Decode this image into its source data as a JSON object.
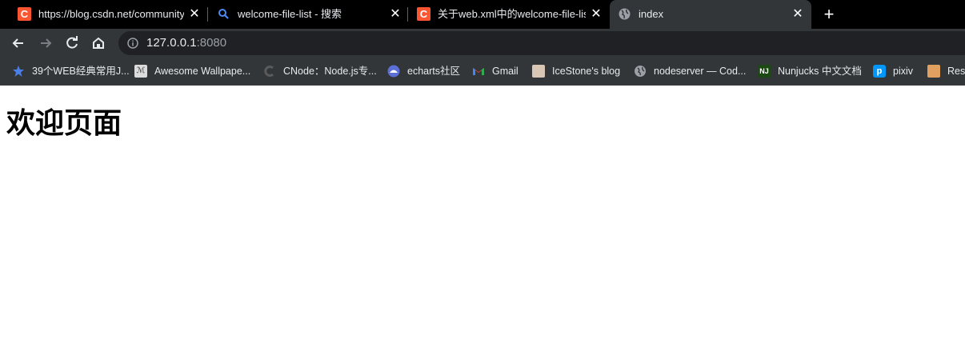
{
  "tabs": [
    {
      "title": "https://blog.csdn.net/community",
      "favicon": "csdn-icon",
      "active": false
    },
    {
      "title": "welcome-file-list - 搜索",
      "favicon": "search-icon",
      "active": false
    },
    {
      "title": "关于web.xml中的welcome-file-list",
      "favicon": "csdn-icon",
      "active": false
    },
    {
      "title": "index",
      "favicon": "globe-icon",
      "active": true
    }
  ],
  "toolbar": {
    "url_host": "127.0.0.1",
    "url_port": ":8080"
  },
  "bookmarks": [
    {
      "label": "39个WEB经典常用J...",
      "icon": "bookmark-star-icon"
    },
    {
      "label": "Awesome Wallpape...",
      "icon": "wallpaper-icon"
    },
    {
      "label": "CNode：Node.js专...",
      "icon": "cnode-icon"
    },
    {
      "label": "echarts社区",
      "icon": "echarts-icon"
    },
    {
      "label": "Gmail",
      "icon": "gmail-icon"
    },
    {
      "label": "IceStone's blog",
      "icon": "avatar-icon"
    },
    {
      "label": "nodeserver — Cod...",
      "icon": "globe-icon"
    },
    {
      "label": "Nunjucks 中文文档",
      "icon": "nunjucks-icon"
    },
    {
      "label": "pixiv",
      "icon": "pixiv-icon"
    },
    {
      "label": "Rese",
      "icon": "avatar-icon"
    }
  ],
  "page": {
    "heading": "欢迎页面"
  },
  "colors": {
    "tabstrip_bg": "#000000",
    "toolbar_bg": "#323639",
    "omnibox_bg": "#202124",
    "csdn_red": "#fc5531",
    "page_bg": "#ffffff"
  }
}
